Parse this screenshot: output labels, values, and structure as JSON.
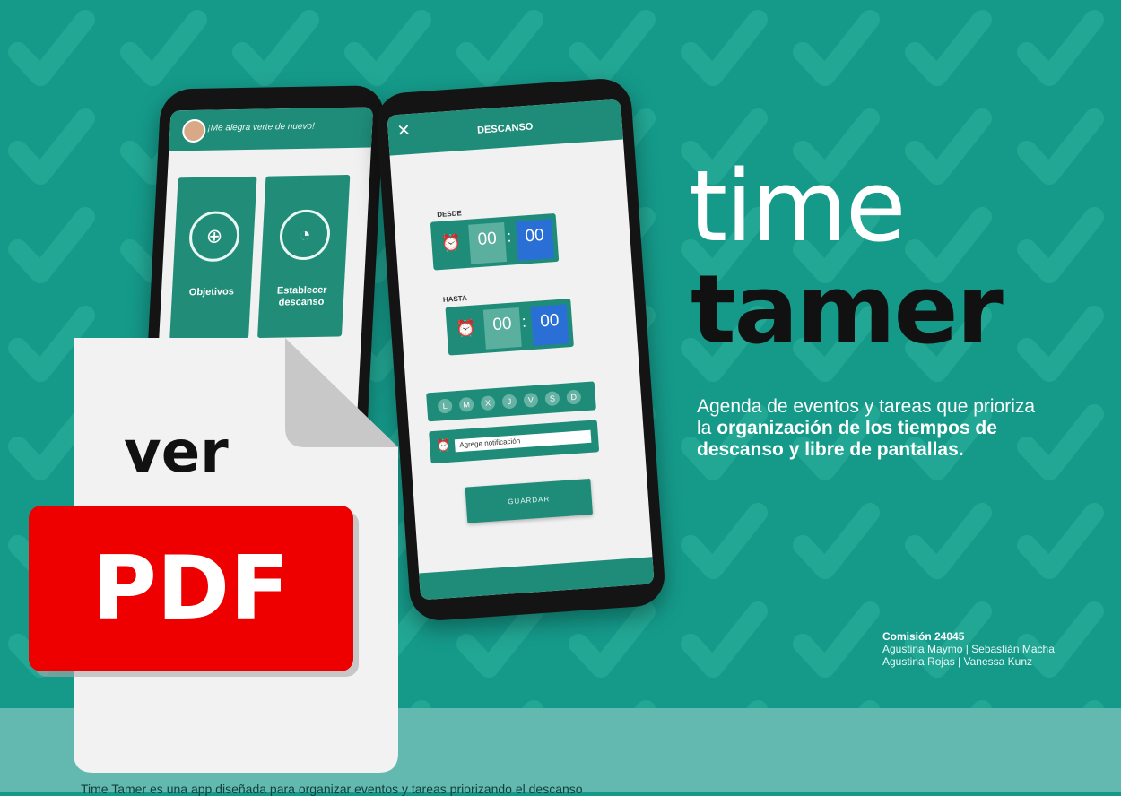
{
  "colors": {
    "background": "#159a8a",
    "band": "#63b9b0",
    "accent_dark": "#1f8c79",
    "pdf_red": "#ee0000"
  },
  "title": {
    "line1": "time",
    "line2": "tamer"
  },
  "description": {
    "part1": "Agenda de eventos y tareas que prioriza la ",
    "bold": "organización de los tiempos de descanso y libre de pantallas."
  },
  "credits": {
    "title": "Comisión 24045",
    "line1": "Agustina Maymo | Sebastián Macha",
    "line2": "Agustina Rojas | Vanessa Kunz"
  },
  "phone_left": {
    "greeting": "¡Me alegra verte de nuevo!",
    "cards": [
      "Objetivos",
      "Establecer descanso"
    ]
  },
  "phone_right": {
    "close_icon": "close-icon",
    "title": "DESCANSO",
    "from_label": "DESDE",
    "to_label": "HASTA",
    "from_hours": "00",
    "from_minutes": "00",
    "to_hours": "00",
    "to_minutes": "00",
    "days": [
      "L",
      "M",
      "X",
      "J",
      "V",
      "S",
      "D"
    ],
    "notification_placeholder": "Agrege notificación",
    "save_label": "GUARDAR"
  },
  "pdf_badge": {
    "top": "ver",
    "bottom": "PDF"
  },
  "bottom_text": "Time Tamer es una app diseñada para organizar eventos y tareas priorizando el descanso"
}
